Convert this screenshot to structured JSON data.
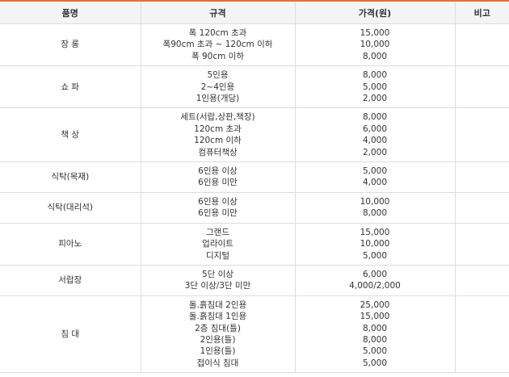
{
  "headers": [
    "품명",
    "규격",
    "가격(원)",
    "비고"
  ],
  "rows": [
    {
      "item": "장 롱",
      "specs": [
        "폭 120cm 초과",
        "폭90cm 초과 ~ 120cm 이하",
        "폭 90cm 이하"
      ],
      "prices": [
        "15,000",
        "10,000",
        "8,000"
      ],
      "note": ""
    },
    {
      "item": "쇼 파",
      "specs": [
        "5인용",
        "2~4인용",
        "1인용(개당)"
      ],
      "prices": [
        "8,000",
        "5,000",
        "2,000"
      ],
      "note": ""
    },
    {
      "item": "책 상",
      "specs": [
        "세트(서랍,상판,책장)",
        "120cm 초과",
        "120cm 이하",
        "컴퓨터책상"
      ],
      "prices": [
        "8,000",
        "6,000",
        "4,000",
        "2,000"
      ],
      "note": ""
    },
    {
      "item": "식탁(목재)",
      "specs": [
        "6인용 이상",
        "6인용 미만"
      ],
      "prices": [
        "5,000",
        "4,000"
      ],
      "note": ""
    },
    {
      "item": "식탁(대리석)",
      "specs": [
        "6인용 이상",
        "6인용 미만"
      ],
      "prices": [
        "10,000",
        "8,000"
      ],
      "note": ""
    },
    {
      "item": "피아노",
      "specs": [
        "그랜드",
        "업라이트",
        "디지털"
      ],
      "prices": [
        "15,000",
        "10,000",
        "5,000"
      ],
      "note": ""
    },
    {
      "item": "서랍장",
      "specs": [
        "5단 이상",
        "3단 이상/3단 미만"
      ],
      "prices": [
        "6,000",
        "4,000/2,000"
      ],
      "note": ""
    },
    {
      "item": "침 대",
      "specs": [
        "돌.흙침대 2인용",
        "돌.흙침대 1인용",
        "2층 침대(틀)",
        "2인용(틀)",
        "1인용(틀)",
        "접이식 침대"
      ],
      "prices": [
        "25,000",
        "15,000",
        "8,000",
        "8,000",
        "5,000",
        "5,000"
      ],
      "note": ""
    }
  ]
}
